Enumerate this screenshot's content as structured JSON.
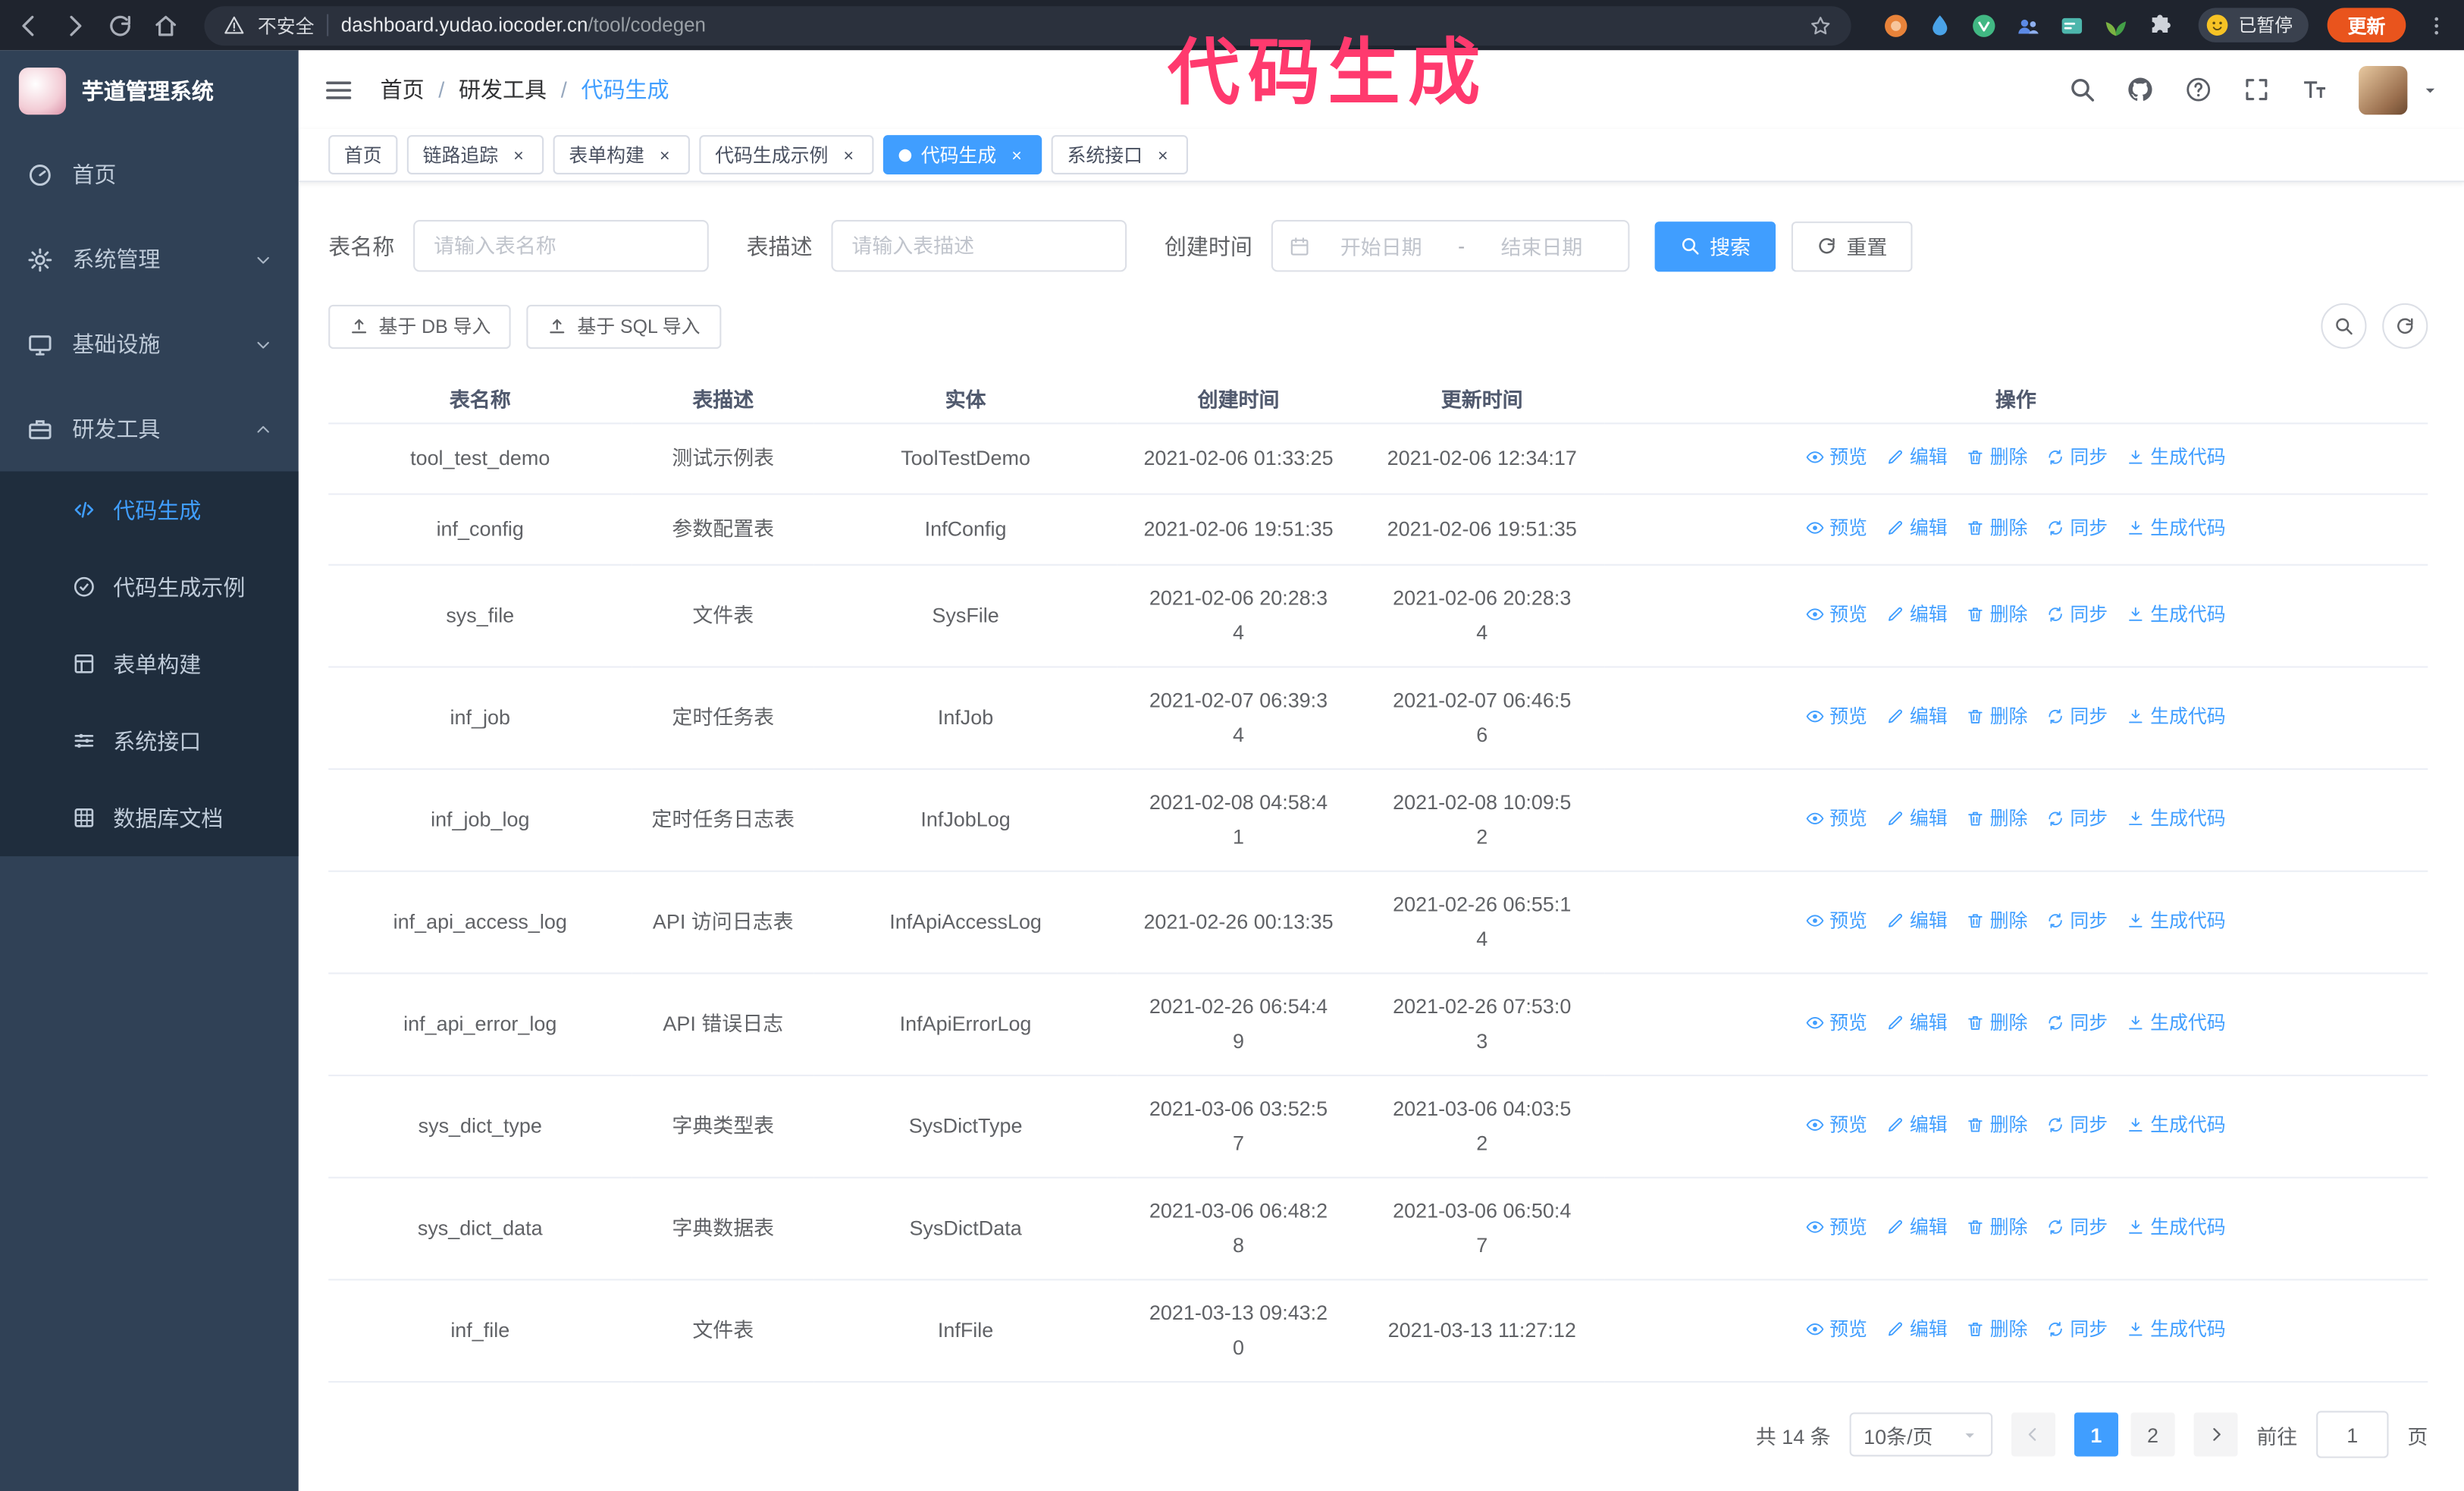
{
  "colors": {
    "accent": "#409eff",
    "annotation": "#ff3a6e",
    "sidebar": "#304156",
    "submenu": "#1f2d3d",
    "update": "#e9541d"
  },
  "icons": {
    "back": "arrow-left",
    "forward": "arrow-right",
    "reload": "circular-arrow",
    "home": "house",
    "security": "warning-triangle",
    "bookmark": "star",
    "extensions": "puzzle-piece",
    "chrome-menu": "three-dots-vertical",
    "profile": "smiley-face",
    "sidebar-toggle": "hamburger",
    "search": "magnifier",
    "repo": "github-octocat",
    "help": "question-circle",
    "fullscreen": "expand-corners",
    "font-size": "double-T",
    "dashboard": "gauge",
    "system": "gear",
    "infra": "monitor",
    "dev-tools": "toolbox",
    "codegen": "code-brackets",
    "example": "circle-check",
    "form": "grid-table",
    "api": "sliders",
    "db-doc": "grid",
    "date": "calendar",
    "import": "upload-arrow",
    "preview": "eye",
    "edit": "pencil",
    "delete": "trash",
    "sync": "circular-arrows",
    "generate": "download-arrow",
    "close": "cross",
    "page-prev": "chevron-left",
    "page-next": "chevron-right",
    "select": "caret-down"
  },
  "browser": {
    "security_warning": "不安全",
    "url_host": "dashboard.yudao.iocoder.cn",
    "url_path": "/tool/codegen",
    "paused_badge": "已暂停",
    "update_button": "更新"
  },
  "annotation": {
    "text": "代码生成"
  },
  "sidebar": {
    "app_title": "芋道管理系统",
    "items": [
      {
        "key": "home",
        "label": "首页",
        "icon": "gauge"
      },
      {
        "key": "system-manage",
        "label": "系统管理",
        "icon": "gear",
        "chevron": "down"
      },
      {
        "key": "infrastructure",
        "label": "基础设施",
        "icon": "monitor",
        "chevron": "down"
      },
      {
        "key": "dev-tools",
        "label": "研发工具",
        "icon": "toolbox",
        "chevron": "up",
        "expanded": true
      }
    ],
    "sub_items": [
      {
        "key": "codegen",
        "label": "代码生成",
        "icon": "code",
        "active": true
      },
      {
        "key": "codegen-example",
        "label": "代码生成示例",
        "icon": "badge"
      },
      {
        "key": "form-builder",
        "label": "表单构建",
        "icon": "form"
      },
      {
        "key": "system-api",
        "label": "系统接口",
        "icon": "sliders"
      },
      {
        "key": "db-doc",
        "label": "数据库文档",
        "icon": "grid"
      }
    ]
  },
  "header": {
    "breadcrumb": [
      "首页",
      "研发工具",
      "代码生成"
    ],
    "separator": "/"
  },
  "tabs": [
    {
      "key": "home",
      "label": "首页",
      "closable": false,
      "active": false
    },
    {
      "key": "tracer",
      "label": "链路追踪",
      "closable": true,
      "active": false
    },
    {
      "key": "form-builder",
      "label": "表单构建",
      "closable": true,
      "active": false
    },
    {
      "key": "codegen-example",
      "label": "代码生成示例",
      "closable": true,
      "active": false
    },
    {
      "key": "codegen",
      "label": "代码生成",
      "closable": true,
      "active": true
    },
    {
      "key": "system-api",
      "label": "系统接口",
      "closable": true,
      "active": false
    }
  ],
  "filters": {
    "table_name_label": "表名称",
    "table_name_placeholder": "请输入表名称",
    "table_desc_label": "表描述",
    "table_desc_placeholder": "请输入表描述",
    "create_time_label": "创建时间",
    "date_start_placeholder": "开始日期",
    "date_separator": "-",
    "date_end_placeholder": "结束日期",
    "search_button": "搜索",
    "reset_button": "重置"
  },
  "toolbar": {
    "import_db": "基于 DB 导入",
    "import_sql": "基于 SQL 导入"
  },
  "table": {
    "columns": [
      "表名称",
      "表描述",
      "实体",
      "创建时间",
      "更新时间",
      "操作"
    ],
    "op_labels": [
      "预览",
      "编辑",
      "删除",
      "同步",
      "生成代码"
    ],
    "rows": [
      {
        "name": "tool_test_demo",
        "desc": "测试示例表",
        "entity": "ToolTestDemo",
        "create_time": "2021-02-06 01:33:25",
        "update_time": "2021-02-06 12:34:17"
      },
      {
        "name": "inf_config",
        "desc": "参数配置表",
        "entity": "InfConfig",
        "create_time": "2021-02-06 19:51:35",
        "update_time": "2021-02-06 19:51:35"
      },
      {
        "name": "sys_file",
        "desc": "文件表",
        "entity": "SysFile",
        "create_time": "2021-02-06 20:28:3\n4",
        "update_time": "2021-02-06 20:28:3\n4"
      },
      {
        "name": "inf_job",
        "desc": "定时任务表",
        "entity": "InfJob",
        "create_time": "2021-02-07 06:39:3\n4",
        "update_time": "2021-02-07 06:46:5\n6"
      },
      {
        "name": "inf_job_log",
        "desc": "定时任务日志表",
        "entity": "InfJobLog",
        "create_time": "2021-02-08 04:58:4\n1",
        "update_time": "2021-02-08 10:09:5\n2"
      },
      {
        "name": "inf_api_access_log",
        "desc": "API 访问日志表",
        "entity": "InfApiAccessLog",
        "create_time": "2021-02-26 00:13:35",
        "update_time": "2021-02-26 06:55:1\n4"
      },
      {
        "name": "inf_api_error_log",
        "desc": "API 错误日志",
        "entity": "InfApiErrorLog",
        "create_time": "2021-02-26 06:54:4\n9",
        "update_time": "2021-02-26 07:53:0\n3"
      },
      {
        "name": "sys_dict_type",
        "desc": "字典类型表",
        "entity": "SysDictType",
        "create_time": "2021-03-06 03:52:5\n7",
        "update_time": "2021-03-06 04:03:5\n2"
      },
      {
        "name": "sys_dict_data",
        "desc": "字典数据表",
        "entity": "SysDictData",
        "create_time": "2021-03-06 06:48:2\n8",
        "update_time": "2021-03-06 06:50:4\n7"
      },
      {
        "name": "inf_file",
        "desc": "文件表",
        "entity": "InfFile",
        "create_time": "2021-03-13 09:43:2\n0",
        "update_time": "2021-03-13 11:27:12"
      }
    ]
  },
  "pagination": {
    "total_text": "共 14 条",
    "page_size": "10条/页",
    "pages": [
      "1",
      "2"
    ],
    "active_page": "1",
    "goto_label": "前往",
    "goto_value": "1",
    "goto_unit": "页"
  }
}
